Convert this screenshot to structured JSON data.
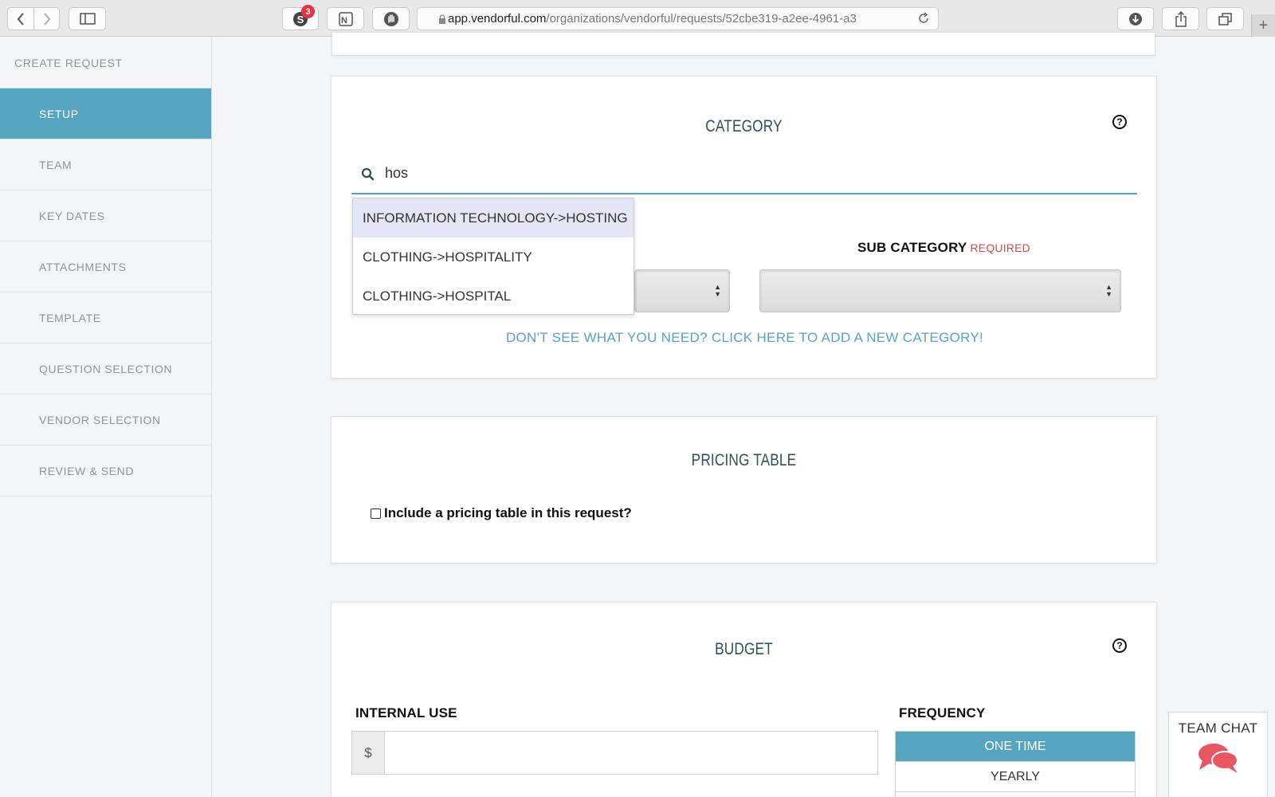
{
  "browser": {
    "extension_badge_count": "3",
    "url_domain": "app.vendorful.com",
    "url_path": "/organizations/vendorful/requests/52cbe319-a2ee-4961-a3"
  },
  "sidebar": {
    "title": "CREATE REQUEST",
    "items": [
      {
        "label": "SETUP",
        "active": true
      },
      {
        "label": "TEAM"
      },
      {
        "label": "KEY DATES"
      },
      {
        "label": "ATTACHMENTS"
      },
      {
        "label": "TEMPLATE"
      },
      {
        "label": "QUESTION SELECTION"
      },
      {
        "label": "VENDOR SELECTION"
      },
      {
        "label": "REVIEW & SEND"
      }
    ]
  },
  "category": {
    "title": "CATEGORY",
    "help": "?",
    "search_value": "hos",
    "suggestions": [
      "INFORMATION TECHNOLOGY->HOSTING",
      "CLOTHING->HOSPITALITY",
      "CLOTHING->HOSPITAL"
    ],
    "sub_category_label": "SUB CATEGORY",
    "required_label": "REQUIRED",
    "add_link": "DON'T SEE WHAT YOU NEED? CLICK HERE TO ADD A NEW CATEGORY!"
  },
  "pricing": {
    "title": "PRICING TABLE",
    "checkbox_label": "Include a pricing table in this request?"
  },
  "budget": {
    "title": "BUDGET",
    "help": "?",
    "internal_use_label": "INTERNAL USE",
    "currency_symbol": "$",
    "frequency_label": "FREQUENCY",
    "frequency_options": [
      "ONE TIME",
      "YEARLY"
    ]
  },
  "team_chat": {
    "label": "TEAM CHAT"
  },
  "colors": {
    "accent": "#55a5c0",
    "heading": "#2c4f5e",
    "required": "#c0504d",
    "chat_icon": "#e8575f"
  }
}
